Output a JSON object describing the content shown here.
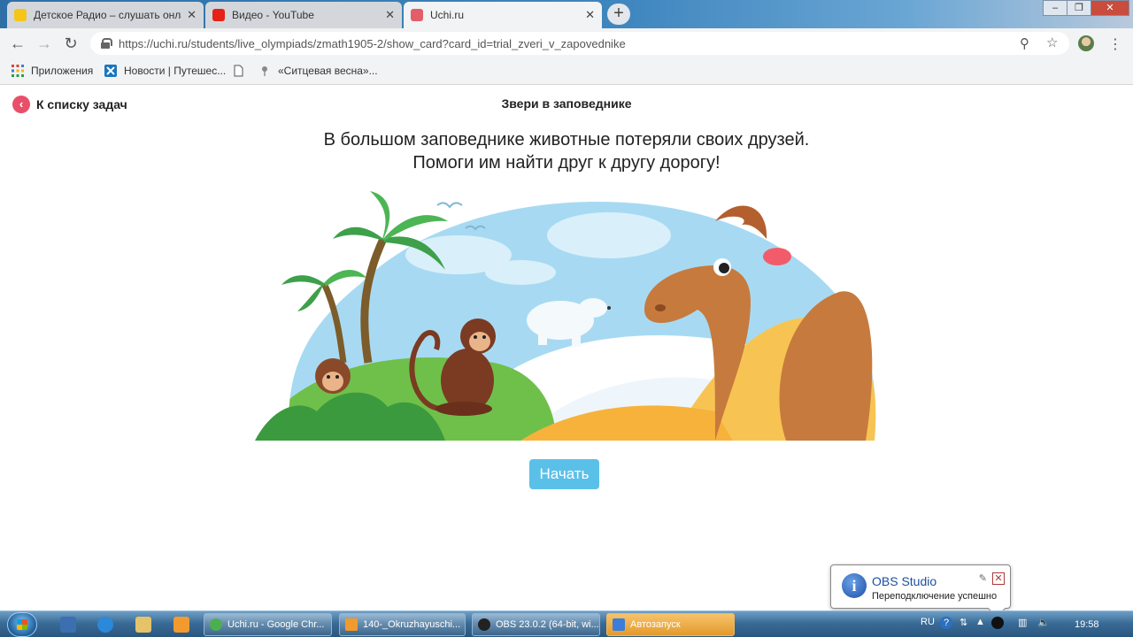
{
  "browser": {
    "tabs": [
      {
        "title": "Детское Радио – слушать онлайн",
        "favicon": "yellow-radio-icon"
      },
      {
        "title": "Видео - YouTube",
        "favicon": "youtube-icon"
      },
      {
        "title": "Uchi.ru",
        "favicon": "uchi-icon"
      }
    ],
    "url": "https://uchi.ru/students/live_olympiads/zmath1905-2/show_card?card_id=trial_zveri_v_zapovednike",
    "bookmarks": [
      {
        "label": "Приложения",
        "icon": "apps-grid-icon"
      },
      {
        "label": "Новости | Путешес...",
        "icon": "bookmark-site-icon"
      },
      {
        "label": "",
        "icon": "page-icon"
      },
      {
        "label": "«Ситцевая весна»...",
        "icon": "bookmark-flower-icon"
      }
    ]
  },
  "page": {
    "back_label": "К списку задач",
    "title": "Звери в заповеднике",
    "description_line1": "В большом заповеднике животные потеряли своих друзей.",
    "description_line2": "Помоги им найти друг к другу дорогу!",
    "start_button": "Начать"
  },
  "notification": {
    "title": "OBS Studio",
    "message": "Переподключение успешно"
  },
  "taskbar": {
    "tasks": [
      {
        "label": "Uchi.ru - Google Chr...",
        "icon_color": "#4caf50"
      },
      {
        "label": "140-_Okruzhayuschi...",
        "icon_color": "#f29a2e"
      },
      {
        "label": "OBS 23.0.2 (64-bit, wi...",
        "icon_color": "#222222"
      },
      {
        "label": "Автозапуск",
        "icon_color": "#3b7dd8"
      }
    ],
    "language": "RU",
    "time": "19:58"
  },
  "colors": {
    "accent_button": "#5bc0e8",
    "back_icon": "#e8506a"
  }
}
